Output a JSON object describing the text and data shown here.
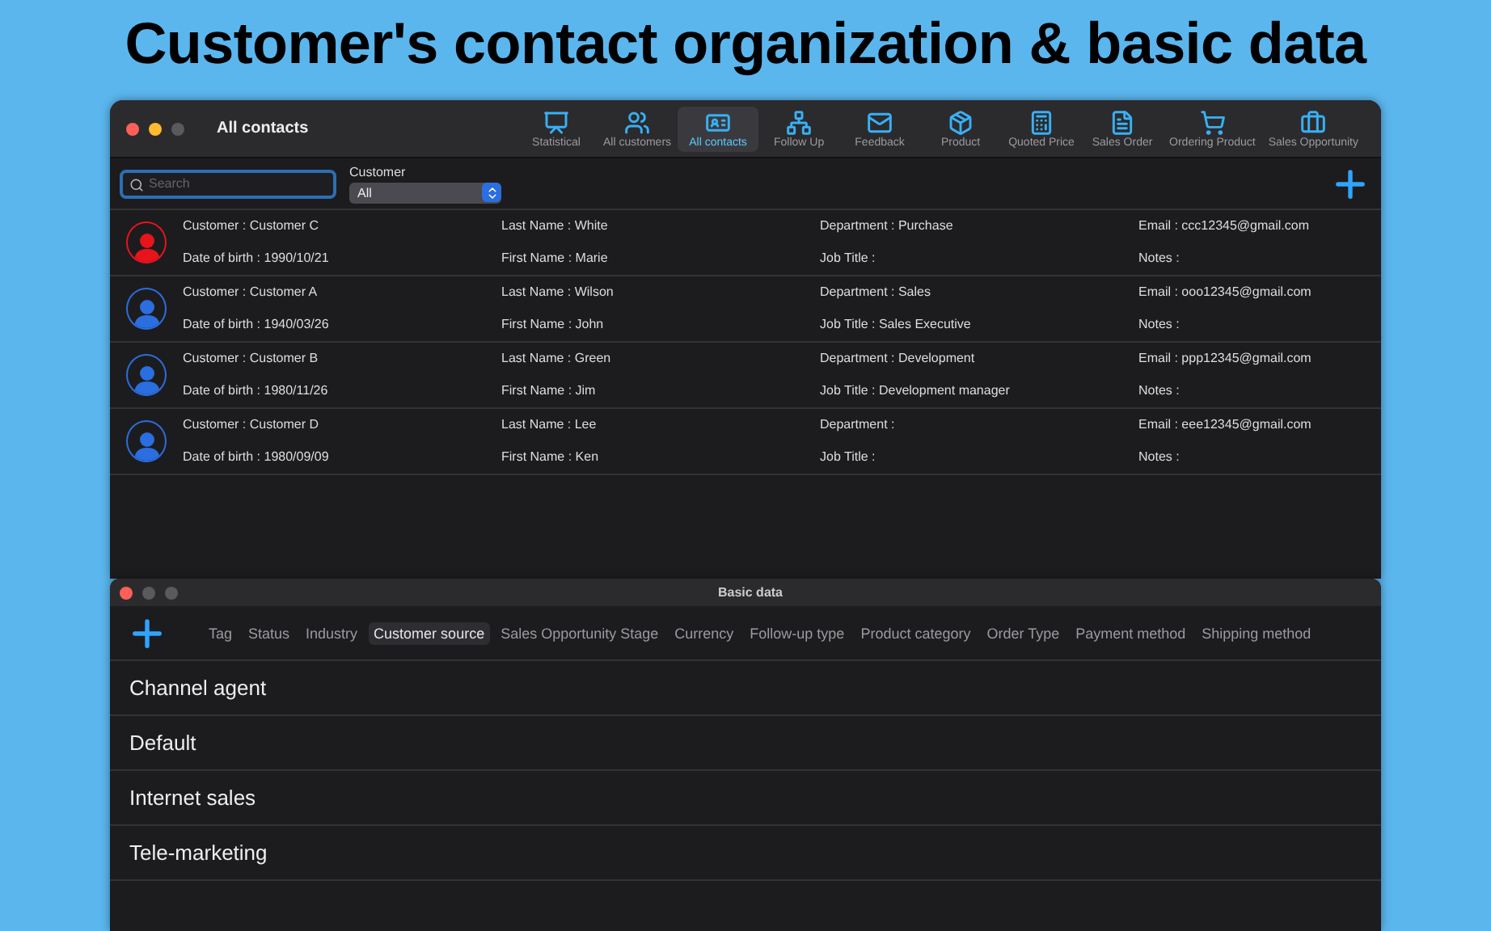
{
  "headline": "Customer's contact organization & basic data",
  "main_window": {
    "title": "All contacts",
    "toolbar": [
      {
        "label": "Statistical",
        "selected": false
      },
      {
        "label": "All customers",
        "selected": false
      },
      {
        "label": "All contacts",
        "selected": true
      },
      {
        "label": "Follow Up",
        "selected": false
      },
      {
        "label": "Feedback",
        "selected": false
      },
      {
        "label": "Product",
        "selected": false
      },
      {
        "label": "Quoted Price",
        "selected": false
      },
      {
        "label": "Sales Order",
        "selected": false
      },
      {
        "label": "Ordering Product",
        "selected": false
      },
      {
        "label": "Sales Opportunity",
        "selected": false
      }
    ],
    "search": {
      "placeholder": "Search"
    },
    "filter": {
      "label": "Customer",
      "value": "All"
    },
    "contacts": [
      {
        "color": "#e8141c",
        "fields": [
          "Customer : Customer C",
          "Date of birth : 1990/10/21",
          "Last Name : White",
          "First Name : Marie",
          "Department : Purchase",
          "Job Title :",
          "Email : ccc12345@gmail.com",
          "Notes :"
        ]
      },
      {
        "color": "#2a6ee0",
        "fields": [
          "Customer : Customer A",
          "Date of birth : 1940/03/26",
          "Last Name : Wilson",
          "First Name : John",
          "Department : Sales",
          "Job Title : Sales Executive",
          "Email : ooo12345@gmail.com",
          "Notes :"
        ]
      },
      {
        "color": "#2a6ee0",
        "fields": [
          "Customer : Customer B",
          "Date of birth : 1980/11/26",
          "Last Name : Green",
          "First Name : Jim",
          "Department : Development",
          "Job Title : Development manager",
          "Email : ppp12345@gmail.com",
          "Notes :"
        ]
      },
      {
        "color": "#2a6ee0",
        "fields": [
          "Customer : Customer D",
          "Date of birth : 1980/09/09",
          "Last Name : Lee",
          "First Name : Ken",
          "Department :",
          "Job Title :",
          "Email : eee12345@gmail.com",
          "Notes :"
        ]
      }
    ]
  },
  "basic_window": {
    "title": "Basic data",
    "tabs": [
      {
        "label": "Tag",
        "selected": false
      },
      {
        "label": "Status",
        "selected": false
      },
      {
        "label": "Industry",
        "selected": false
      },
      {
        "label": "Customer source",
        "selected": true
      },
      {
        "label": "Sales Opportunity Stage",
        "selected": false
      },
      {
        "label": "Currency",
        "selected": false
      },
      {
        "label": "Follow-up type",
        "selected": false
      },
      {
        "label": "Product category",
        "selected": false
      },
      {
        "label": "Order Type",
        "selected": false
      },
      {
        "label": "Payment method",
        "selected": false
      },
      {
        "label": "Shipping method",
        "selected": false
      }
    ],
    "items": [
      "Channel agent",
      "Default",
      "Internet sales",
      "Tele-marketing"
    ]
  }
}
